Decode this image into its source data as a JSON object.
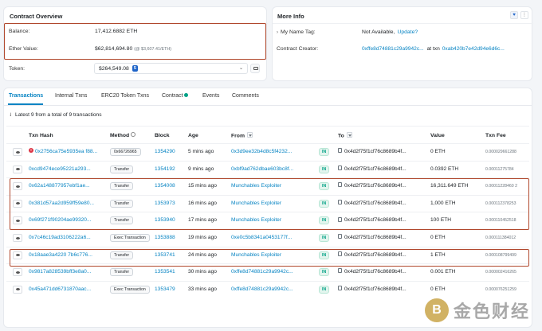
{
  "overview": {
    "title": "Contract Overview",
    "balance_label": "Balance:",
    "balance_value": "17,412.6882 ETH",
    "ether_value_label": "Ether Value:",
    "ether_value": "$62,814,694.80",
    "ether_value_rate": "(@ $3,607.41/ETH)",
    "token_label": "Token:",
    "token_value": "$264,549.08",
    "token_count": "5"
  },
  "more_info": {
    "title": "More Info",
    "name_tag_label": "My Name Tag:",
    "name_tag_value": "Not Available,",
    "name_tag_link": "Update?",
    "creator_label": "Contract Creator:",
    "creator_address": "0xffe8d74881c29a9942c...",
    "creator_at_txn": "at txn",
    "creator_txn": "0xab420b7e42d94e6d6c..."
  },
  "tabs": [
    "Transactions",
    "Internal Txns",
    "ERC20 Token Txns",
    "Contract",
    "Events",
    "Comments"
  ],
  "summary": "Latest 9 from a total of 9 transactions",
  "columns": {
    "hash": "Txn Hash",
    "method": "Method",
    "block": "Block",
    "age": "Age",
    "from": "From",
    "to": "To",
    "value": "Value",
    "fee": "Txn Fee"
  },
  "rows": [
    {
      "hash": "0x2756ca75e5935ea f88...",
      "method": "0x66726965",
      "block": "1354290",
      "age": "5 mins ago",
      "from": "0x3d9ee32b4d8c5f4232...",
      "dir": "IN",
      "to": "0x4d2f75f1cf76c8689b4f...",
      "value": "0 ETH",
      "fee": "0.000029661288",
      "error": true
    },
    {
      "hash": "0xcd9474ece95221a293...",
      "method": "Transfer",
      "block": "1354192",
      "age": "9 mins ago",
      "from": "0xbf9ad762dbae603bc8f...",
      "dir": "IN",
      "to": "0x4d2f75f1cf76c8689b4f...",
      "value": "0.0392 ETH",
      "fee": "0.00011275784",
      "error": false
    },
    {
      "hash": "0x62a148877957ebf1ae...",
      "method": "Transfer",
      "block": "1354008",
      "age": "15 mins ago",
      "from": "Munchables Exploiter",
      "dir": "IN",
      "to": "0x4d2f75f1cf76c8689b4f...",
      "value": "16,311.649 ETH",
      "fee": "0.00011228460 2",
      "error": false
    },
    {
      "hash": "0x381d57aa2d959ff59e80...",
      "method": "Transfer",
      "block": "1353973",
      "age": "16 mins ago",
      "from": "Munchables Exploiter",
      "dir": "IN",
      "to": "0x4d2f75f1cf76c8689b4f...",
      "value": "1,000 ETH",
      "fee": "0.000112378253",
      "error": false
    },
    {
      "hash": "0x69f271f90204ae99320...",
      "method": "Transfer",
      "block": "1353940",
      "age": "17 mins ago",
      "from": "Munchables Exploiter",
      "dir": "IN",
      "to": "0x4d2f75f1cf76c8689b4f...",
      "value": "100 ETH",
      "fee": "0.000110452518",
      "error": false
    },
    {
      "hash": "0x7c46c19ad3106222a6...",
      "method": "Exec Transaction",
      "block": "1353888",
      "age": "19 mins ago",
      "from": "0xe0c5b8341a0453177f...",
      "dir": "IN",
      "to": "0x4d2f75f1cf76c8689b4f...",
      "value": "0 ETH",
      "fee": "0.000111384012",
      "error": false
    },
    {
      "hash": "0x18aae3a4220 7b6c776...",
      "method": "Transfer",
      "block": "1353741",
      "age": "24 mins ago",
      "from": "Munchables Exploiter",
      "dir": "IN",
      "to": "0x4d2f75f1cf76c8689b4f...",
      "value": "1 ETH",
      "fee": "0.000108799499",
      "error": false
    },
    {
      "hash": "0x9817a828539bff3e8a0...",
      "method": "Transfer",
      "block": "1353541",
      "age": "30 mins ago",
      "from": "0xffe8d74881c29a9942c...",
      "dir": "IN",
      "to": "0x4d2f75f1cf76c8689b4f...",
      "value": "0.001 ETH",
      "fee": "0.000002416265",
      "error": false
    },
    {
      "hash": "0x45a471dd6731870aac...",
      "method": "Exec Transaction",
      "block": "1353479",
      "age": "33 mins ago",
      "from": "0xffe8d74881c29a9942c...",
      "dir": "IN",
      "to": "0x4d2f75f1cf76c8689b4f...",
      "value": "0 ETH",
      "fee": "0.000076251259",
      "error": false
    }
  ],
  "watermark": "金色财经",
  "colors": {
    "link": "#0784c3",
    "highlight": "#b0472c",
    "in_badge": "#00a186"
  }
}
